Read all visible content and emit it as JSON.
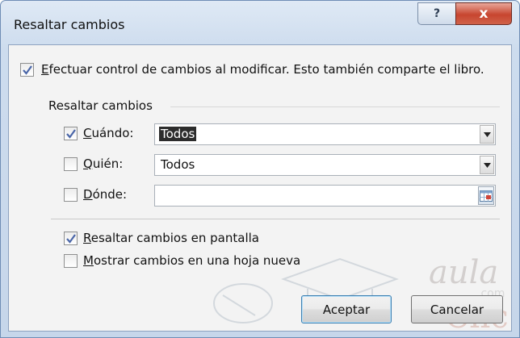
{
  "window": {
    "title": "Resaltar cambios",
    "help_glyph": "?",
    "close_glyph": "x",
    "accent_close": "#c7452f"
  },
  "track_changes": {
    "checked": true,
    "prefix": "E",
    "rest": "fectuar control de cambios al modificar. Esto también comparte el libro."
  },
  "highlight_group": {
    "label": "Resaltar cambios",
    "when": {
      "checked": true,
      "prefix": "C",
      "rest": "uándo:",
      "value": "Todos",
      "selected": true
    },
    "who": {
      "checked": false,
      "prefix": "Q",
      "rest": "uién:",
      "value": "Todos"
    },
    "where": {
      "checked": false,
      "prefix": "D",
      "rest": "ónde:",
      "value": ""
    }
  },
  "options": {
    "on_screen": {
      "checked": true,
      "prefix": "R",
      "rest": "esaltar cambios en pantalla"
    },
    "new_sheet": {
      "checked": false,
      "prefix": "M",
      "rest": "ostrar cambios en una hoja nueva"
    }
  },
  "buttons": {
    "accept": "Aceptar",
    "cancel": "Cancelar"
  },
  "watermark": {
    "text1": "aula",
    "text2": "Clic",
    "text3": ".com"
  }
}
